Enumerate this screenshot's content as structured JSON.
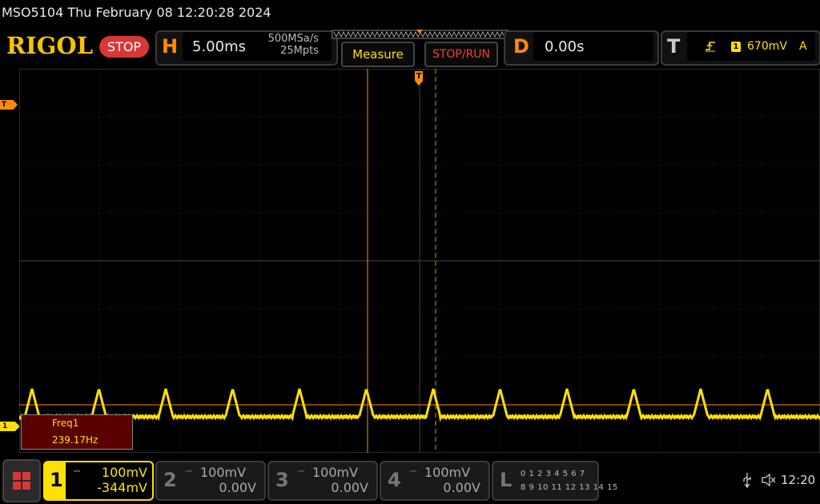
{
  "topbar": {
    "title": "MSO5104  Thu February 08 12:20:28 2024"
  },
  "header": {
    "brand": "RIGOL",
    "run_state": "STOP",
    "horizontal": {
      "letter": "H",
      "timebase": "5.00ms",
      "sample_rate": "500MSa/s",
      "memory_depth": "25Mpts"
    },
    "measure_label": "Measure",
    "stop_run_label": "STOP/RUN",
    "delay": {
      "letter": "D",
      "value": "0.00s"
    },
    "trigger": {
      "letter": "T",
      "source": "1",
      "level": "670mV",
      "mode": "A"
    }
  },
  "markers": {
    "trigger_marker": "T",
    "ch1_marker": "1",
    "trigger_level_marker": "T"
  },
  "measurement": {
    "label": "Freq1",
    "value": "239.17Hz"
  },
  "channels": [
    {
      "num": "1",
      "scale": "100mV",
      "offset": "-344mV",
      "color": "#ffe000"
    },
    {
      "num": "2",
      "scale": "100mV",
      "offset": "0.00V",
      "color": "#888888"
    },
    {
      "num": "3",
      "scale": "100mV",
      "offset": "0.00V",
      "color": "#888888"
    },
    {
      "num": "4",
      "scale": "100mV",
      "offset": "0.00V",
      "color": "#888888"
    }
  ],
  "logic": {
    "letter": "L",
    "row1": "0 1 2 3   4 5 6 7",
    "row2": "8  9 10 11  12 13 14 15"
  },
  "status": {
    "time": "12:20"
  },
  "colors": {
    "accent": "#ff8c00",
    "ch1": "#ffe000",
    "stop": "#d93636"
  }
}
